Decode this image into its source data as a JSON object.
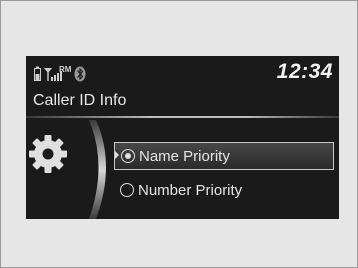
{
  "screen": {
    "time": "12:34",
    "title": "Caller ID Info",
    "status_icons": [
      "battery-icon",
      "signal-strength-icon",
      "roaming-icon",
      "bluetooth-icon"
    ],
    "roaming_label": "RM"
  },
  "settings_icon": "gear-icon",
  "options": [
    {
      "label": "Name Priority",
      "selected": true
    },
    {
      "label": "Number Priority",
      "selected": false
    }
  ],
  "colors": {
    "screen_bg": "#1a1a1a",
    "text": "#e6e6e6",
    "frame_bg": "#e6e6e6"
  }
}
